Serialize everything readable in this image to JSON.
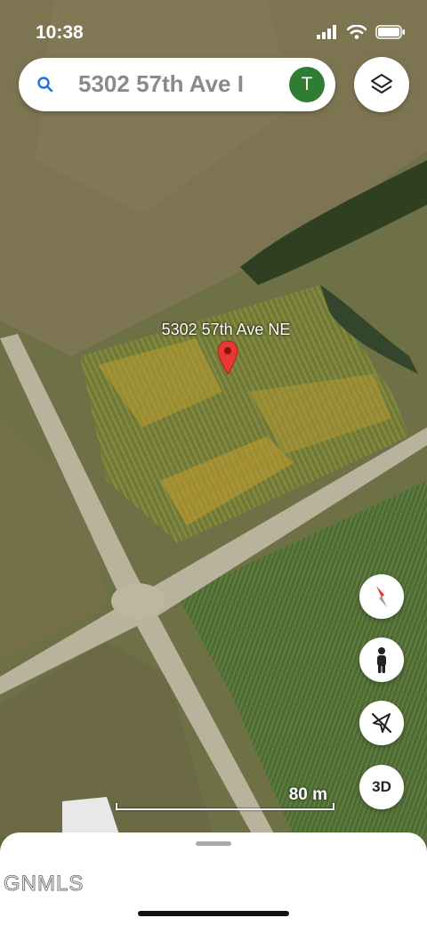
{
  "status_bar": {
    "time": "10:38"
  },
  "search": {
    "query": "5302 57th Ave I",
    "avatar_letter": "T"
  },
  "map": {
    "place_label": "5302 57th Ave NE",
    "scale_label": "80 m"
  },
  "controls": {
    "three_d_label": "3D"
  },
  "bottom_sheet": {
    "watermark": "GNMLS"
  },
  "colors": {
    "pin": "#e53935",
    "avatar": "#2e7d32",
    "search_icon": "#1a73e8"
  }
}
